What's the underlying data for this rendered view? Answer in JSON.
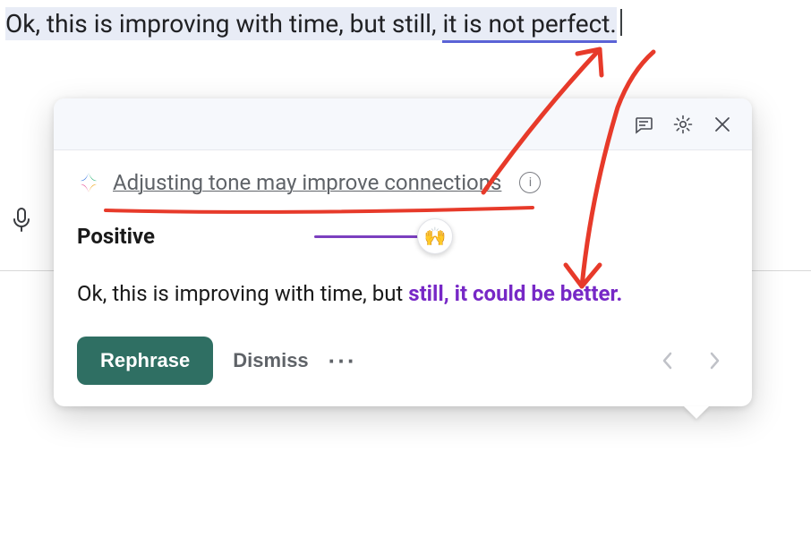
{
  "editor": {
    "text_before_flag": "Ok, this is improving with time, but still, ",
    "text_flagged": "it is not perfect.",
    "cursor_after": true
  },
  "popup": {
    "header": {
      "feedback_aria": "Feedback",
      "settings_aria": "Settings",
      "close_aria": "Close"
    },
    "heading": "Adjusting tone may improve connections",
    "info_aria": "More info",
    "tone": {
      "label": "Positive",
      "emoji": "🙌"
    },
    "suggestion": {
      "unchanged": "Ok, this is improving with time, but ",
      "changed": "still, it could be better."
    },
    "actions": {
      "rephrase": "Rephrase",
      "dismiss": "Dismiss",
      "more_aria": "More options",
      "prev_aria": "Previous suggestion",
      "next_aria": "Next suggestion"
    }
  },
  "annotation": {
    "title_underline_color": "#e73a2a",
    "arrow_color": "#e73a2a"
  }
}
